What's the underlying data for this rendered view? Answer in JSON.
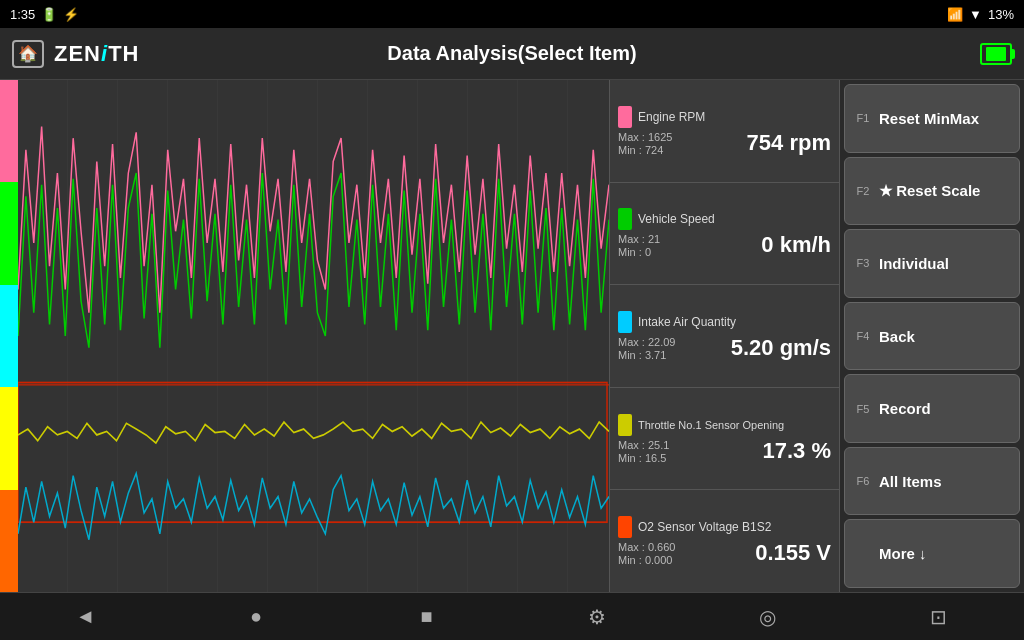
{
  "statusBar": {
    "time": "1:35",
    "battery": "13%"
  },
  "header": {
    "title": "Data Analysis(Select Item)",
    "logo": "ZENiTH"
  },
  "dataItems": [
    {
      "id": "engine-rpm",
      "label": "Engine RPM",
      "color": "#ff6b9d",
      "value": "754 rpm",
      "maxLabel": "Max : 1625",
      "minLabel": "Min :  724"
    },
    {
      "id": "vehicle-speed",
      "label": "Vehicle Speed",
      "color": "#00cc00",
      "value": "0 km/h",
      "maxLabel": "Max :  21",
      "minLabel": "Min :   0"
    },
    {
      "id": "intake-air",
      "label": "Intake Air Quantity",
      "color": "#00ccff",
      "value": "5.20 gm/s",
      "maxLabel": "Max : 22.09",
      "minLabel": "Min :  3.71"
    },
    {
      "id": "throttle",
      "label": "Throttle No.1 Sensor Opening",
      "color": "#cccc00",
      "value": "17.3 %",
      "maxLabel": "Max : 25.1",
      "minLabel": "Min : 16.5"
    },
    {
      "id": "o2-sensor",
      "label": "O2 Sensor Voltage B1S2",
      "color": "#ff4400",
      "value": "0.155 V",
      "maxLabel": "Max : 0.660",
      "minLabel": "Min : 0.000"
    }
  ],
  "fnButtons": [
    {
      "id": "reset-minmax",
      "label": "F1",
      "text": "Reset MinMax",
      "star": false
    },
    {
      "id": "reset-scale",
      "label": "F2",
      "text": "Reset Scale",
      "star": true
    },
    {
      "id": "individual",
      "label": "F3",
      "text": "Individual",
      "star": false
    },
    {
      "id": "back",
      "label": "F4",
      "text": "Back",
      "star": false
    },
    {
      "id": "record",
      "label": "F5",
      "text": "Record",
      "star": false
    },
    {
      "id": "all-items",
      "label": "F6",
      "text": "All Items",
      "star": false
    },
    {
      "id": "more",
      "label": "",
      "text": "More ↓",
      "star": false
    }
  ],
  "bottomNav": {
    "back": "◄",
    "home": "●",
    "square": "■",
    "settings": "⚙",
    "chrome": "◎",
    "camera": "⊡"
  }
}
